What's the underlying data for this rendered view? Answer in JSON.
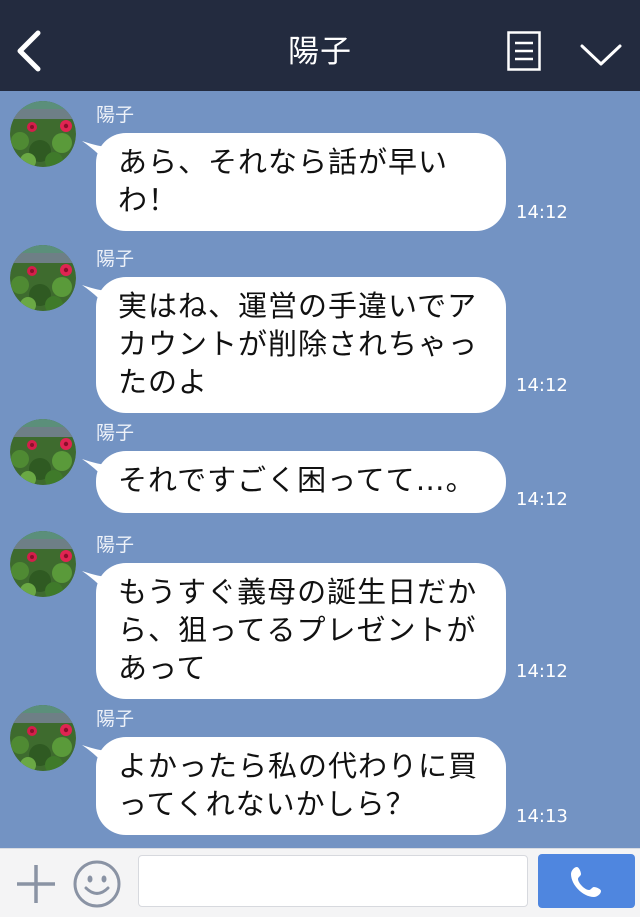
{
  "header": {
    "title": "陽子"
  },
  "messages": [
    {
      "sender": "陽子",
      "text": "あら、それなら話が早いわ！",
      "time": "14:12"
    },
    {
      "sender": "陽子",
      "text": "実はね、運営の手違いでアカウントが削除されちゃったのよ",
      "time": "14:12"
    },
    {
      "sender": "陽子",
      "text": "それですごく困ってて…。",
      "time": "14:12"
    },
    {
      "sender": "陽子",
      "text": "もうすぐ義母の誕生日だから、狙ってるプレゼントがあって",
      "time": "14:12"
    },
    {
      "sender": "陽子",
      "text": "よかったら私の代わりに買ってくれないかしら？",
      "time": "14:13"
    }
  ],
  "footer": {
    "input_value": "",
    "input_placeholder": ""
  },
  "colors": {
    "header_bg": "#232b3f",
    "chat_bg": "#7393c3",
    "bubble_bg": "#ffffff",
    "call_button": "#4f86df"
  },
  "icons": {
    "back": "chevron-left-icon",
    "menu": "menu-icon",
    "collapse": "chevron-down-icon",
    "add": "plus-icon",
    "emoji": "smiley-icon",
    "call": "phone-icon"
  }
}
